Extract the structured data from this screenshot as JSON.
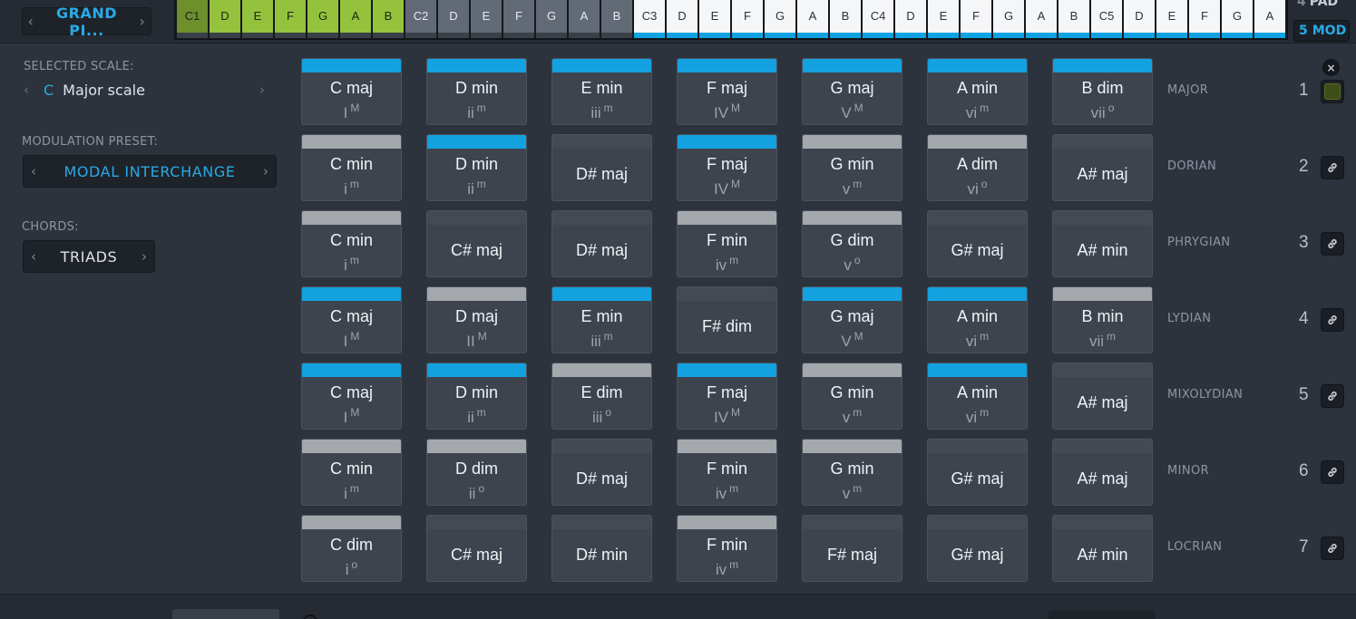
{
  "topbar": {
    "instrument": "GRAND PI...",
    "keys": [
      {
        "label": "C1",
        "style": "green-dark"
      },
      {
        "label": "D",
        "style": "green"
      },
      {
        "label": "E",
        "style": "green"
      },
      {
        "label": "F",
        "style": "green"
      },
      {
        "label": "G",
        "style": "green"
      },
      {
        "label": "A",
        "style": "green"
      },
      {
        "label": "B",
        "style": "green"
      },
      {
        "label": "C2",
        "style": "gray"
      },
      {
        "label": "D",
        "style": "gray"
      },
      {
        "label": "E",
        "style": "gray"
      },
      {
        "label": "F",
        "style": "gray"
      },
      {
        "label": "G",
        "style": "gray"
      },
      {
        "label": "A",
        "style": "gray"
      },
      {
        "label": "B",
        "style": "gray"
      },
      {
        "label": "C3",
        "style": "white"
      },
      {
        "label": "D",
        "style": "white"
      },
      {
        "label": "E",
        "style": "white"
      },
      {
        "label": "F",
        "style": "white"
      },
      {
        "label": "G",
        "style": "white"
      },
      {
        "label": "A",
        "style": "white"
      },
      {
        "label": "B",
        "style": "white"
      },
      {
        "label": "C4",
        "style": "white"
      },
      {
        "label": "D",
        "style": "white"
      },
      {
        "label": "E",
        "style": "white"
      },
      {
        "label": "F",
        "style": "white"
      },
      {
        "label": "G",
        "style": "white"
      },
      {
        "label": "A",
        "style": "white"
      },
      {
        "label": "B",
        "style": "white"
      },
      {
        "label": "C5",
        "style": "white"
      },
      {
        "label": "D",
        "style": "white"
      },
      {
        "label": "E",
        "style": "white"
      },
      {
        "label": "F",
        "style": "white"
      },
      {
        "label": "G",
        "style": "white"
      },
      {
        "label": "A",
        "style": "white"
      }
    ],
    "pad_num": "4",
    "pad_label": "PAD",
    "mod_num": "5",
    "mod_label": "MOD"
  },
  "left": {
    "scale_label": "SELECTED SCALE:",
    "scale_root": "C",
    "scale_name": "Major scale",
    "modulation_label": "MODULATION PRESET:",
    "modulation_value": "MODAL INTERCHANGE",
    "chords_label": "CHORDS:",
    "chords_value": "TRIADS"
  },
  "colors": {
    "accent": "#14a1e0",
    "active_green": "#95c23c"
  },
  "grid": {
    "close_icon": "×",
    "rows": [
      {
        "mode": "MAJOR",
        "num": "1",
        "control": "led",
        "chords": [
          {
            "name": "C maj",
            "roman": "I",
            "q": "M",
            "state": "on"
          },
          {
            "name": "D min",
            "roman": "ii",
            "q": "m",
            "state": "on"
          },
          {
            "name": "E min",
            "roman": "iii",
            "q": "m",
            "state": "on"
          },
          {
            "name": "F maj",
            "roman": "IV",
            "q": "M",
            "state": "on"
          },
          {
            "name": "G maj",
            "roman": "V",
            "q": "M",
            "state": "on"
          },
          {
            "name": "A min",
            "roman": "vi",
            "q": "m",
            "state": "on"
          },
          {
            "name": "B dim",
            "roman": "vii",
            "q": "o",
            "state": "on"
          }
        ]
      },
      {
        "mode": "DORIAN",
        "num": "2",
        "control": "link",
        "chords": [
          {
            "name": "C min",
            "roman": "i",
            "q": "m",
            "state": "off"
          },
          {
            "name": "D min",
            "roman": "ii",
            "q": "m",
            "state": "on"
          },
          {
            "name": "D# maj",
            "roman": "",
            "q": "",
            "state": "plain"
          },
          {
            "name": "F maj",
            "roman": "IV",
            "q": "M",
            "state": "on"
          },
          {
            "name": "G min",
            "roman": "v",
            "q": "m",
            "state": "off"
          },
          {
            "name": "A dim",
            "roman": "vi",
            "q": "o",
            "state": "off"
          },
          {
            "name": "A# maj",
            "roman": "",
            "q": "",
            "state": "plain"
          }
        ]
      },
      {
        "mode": "PHRYGIAN",
        "num": "3",
        "control": "link",
        "chords": [
          {
            "name": "C min",
            "roman": "i",
            "q": "m",
            "state": "off"
          },
          {
            "name": "C# maj",
            "roman": "",
            "q": "",
            "state": "plain"
          },
          {
            "name": "D# maj",
            "roman": "",
            "q": "",
            "state": "plain"
          },
          {
            "name": "F min",
            "roman": "iv",
            "q": "m",
            "state": "off"
          },
          {
            "name": "G dim",
            "roman": "v",
            "q": "o",
            "state": "off"
          },
          {
            "name": "G# maj",
            "roman": "",
            "q": "",
            "state": "plain"
          },
          {
            "name": "A# min",
            "roman": "",
            "q": "",
            "state": "plain"
          }
        ]
      },
      {
        "mode": "LYDIAN",
        "num": "4",
        "control": "link",
        "chords": [
          {
            "name": "C maj",
            "roman": "I",
            "q": "M",
            "state": "on"
          },
          {
            "name": "D maj",
            "roman": "II",
            "q": "M",
            "state": "off"
          },
          {
            "name": "E min",
            "roman": "iii",
            "q": "m",
            "state": "on"
          },
          {
            "name": "F# dim",
            "roman": "",
            "q": "",
            "state": "plain"
          },
          {
            "name": "G maj",
            "roman": "V",
            "q": "M",
            "state": "on"
          },
          {
            "name": "A min",
            "roman": "vi",
            "q": "m",
            "state": "on"
          },
          {
            "name": "B min",
            "roman": "vii",
            "q": "m",
            "state": "off"
          }
        ]
      },
      {
        "mode": "MIXOLYDIAN",
        "num": "5",
        "control": "link",
        "chords": [
          {
            "name": "C maj",
            "roman": "I",
            "q": "M",
            "state": "on"
          },
          {
            "name": "D min",
            "roman": "ii",
            "q": "m",
            "state": "on"
          },
          {
            "name": "E dim",
            "roman": "iii",
            "q": "o",
            "state": "off"
          },
          {
            "name": "F maj",
            "roman": "IV",
            "q": "M",
            "state": "on"
          },
          {
            "name": "G min",
            "roman": "v",
            "q": "m",
            "state": "off"
          },
          {
            "name": "A min",
            "roman": "vi",
            "q": "m",
            "state": "on"
          },
          {
            "name": "A# maj",
            "roman": "",
            "q": "",
            "state": "plain"
          }
        ]
      },
      {
        "mode": "MINOR",
        "num": "6",
        "control": "link",
        "chords": [
          {
            "name": "C min",
            "roman": "i",
            "q": "m",
            "state": "off"
          },
          {
            "name": "D dim",
            "roman": "ii",
            "q": "o",
            "state": "off"
          },
          {
            "name": "D# maj",
            "roman": "",
            "q": "",
            "state": "plain"
          },
          {
            "name": "F min",
            "roman": "iv",
            "q": "m",
            "state": "off"
          },
          {
            "name": "G min",
            "roman": "v",
            "q": "m",
            "state": "off"
          },
          {
            "name": "G# maj",
            "roman": "",
            "q": "",
            "state": "plain"
          },
          {
            "name": "A# maj",
            "roman": "",
            "q": "",
            "state": "plain"
          }
        ]
      },
      {
        "mode": "LOCRIAN",
        "num": "7",
        "control": "link",
        "chords": [
          {
            "name": "C dim",
            "roman": "i",
            "q": "o",
            "state": "off"
          },
          {
            "name": "C# maj",
            "roman": "",
            "q": "",
            "state": "plain"
          },
          {
            "name": "D# min",
            "roman": "",
            "q": "",
            "state": "plain"
          },
          {
            "name": "F min",
            "roman": "iv",
            "q": "m",
            "state": "off"
          },
          {
            "name": "F# maj",
            "roman": "",
            "q": "",
            "state": "plain"
          },
          {
            "name": "G# maj",
            "roman": "",
            "q": "",
            "state": "plain"
          },
          {
            "name": "A# min",
            "roman": "",
            "q": "",
            "state": "plain"
          }
        ]
      }
    ]
  }
}
